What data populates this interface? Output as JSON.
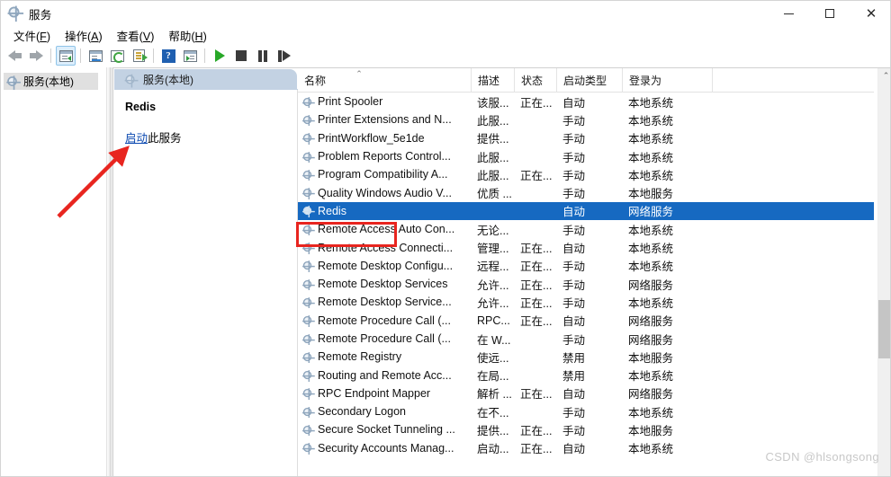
{
  "window": {
    "title": "服务",
    "icon": "services-gear-icon",
    "minimize_label": "—",
    "maximize_label": "□",
    "close_label": "✕"
  },
  "menu": [
    {
      "pre": "文件(",
      "key": "F",
      "post": ")"
    },
    {
      "pre": "操作(",
      "key": "A",
      "post": ")"
    },
    {
      "pre": "查看(",
      "key": "V",
      "post": ")"
    },
    {
      "pre": "帮助(",
      "key": "H",
      "post": ")"
    }
  ],
  "toolbar": [
    {
      "name": "back-button",
      "icon": "arrow-left-icon"
    },
    {
      "name": "forward-button",
      "icon": "arrow-right-icon"
    },
    {
      "name": "show-hide-tree-button",
      "icon": "console-tree-icon"
    },
    {
      "name": "properties-button",
      "icon": "properties-window-icon"
    },
    {
      "name": "refresh-button",
      "icon": "refresh-icon"
    },
    {
      "name": "export-list-button",
      "icon": "export-list-icon"
    },
    {
      "name": "help-button",
      "icon": "help-question-icon"
    },
    {
      "name": "show-action-pane-button",
      "icon": "action-pane-icon"
    },
    {
      "name": "start-service-button",
      "icon": "play-icon"
    },
    {
      "name": "stop-service-button",
      "icon": "stop-icon"
    },
    {
      "name": "pause-service-button",
      "icon": "pause-icon"
    },
    {
      "name": "restart-service-button",
      "icon": "restart-icon"
    }
  ],
  "tree": {
    "root_label": "服务(本地)"
  },
  "pane": {
    "tab_label": "服务(本地)",
    "selected_service": "Redis",
    "action_link": "启动",
    "action_suffix": "此服务"
  },
  "list": {
    "columns": [
      {
        "key": "name",
        "label": "名称",
        "sorted": "asc"
      },
      {
        "key": "desc",
        "label": "描述"
      },
      {
        "key": "state",
        "label": "状态"
      },
      {
        "key": "start",
        "label": "启动类型"
      },
      {
        "key": "logon",
        "label": "登录为"
      }
    ],
    "sort_indicator": "⌃",
    "rows": [
      {
        "name": "Print Spooler",
        "desc": "该服...",
        "state": "正在...",
        "start": "自动",
        "logon": "本地系统",
        "selected": false
      },
      {
        "name": "Printer Extensions and N...",
        "desc": "此服...",
        "state": "",
        "start": "手动",
        "logon": "本地系统",
        "selected": false
      },
      {
        "name": "PrintWorkflow_5e1de",
        "desc": "提供...",
        "state": "",
        "start": "手动",
        "logon": "本地系统",
        "selected": false
      },
      {
        "name": "Problem Reports Control...",
        "desc": "此服...",
        "state": "",
        "start": "手动",
        "logon": "本地系统",
        "selected": false
      },
      {
        "name": "Program Compatibility A...",
        "desc": "此服...",
        "state": "正在...",
        "start": "手动",
        "logon": "本地系统",
        "selected": false
      },
      {
        "name": "Quality Windows Audio V...",
        "desc": "优质 ...",
        "state": "",
        "start": "手动",
        "logon": "本地服务",
        "selected": false
      },
      {
        "name": "Redis",
        "desc": "",
        "state": "",
        "start": "自动",
        "logon": "网络服务",
        "selected": true
      },
      {
        "name": "Remote Access Auto Con...",
        "desc": "无论...",
        "state": "",
        "start": "手动",
        "logon": "本地系统",
        "selected": false
      },
      {
        "name": "Remote Access Connecti...",
        "desc": "管理...",
        "state": "正在...",
        "start": "自动",
        "logon": "本地系统",
        "selected": false
      },
      {
        "name": "Remote Desktop Configu...",
        "desc": "远程...",
        "state": "正在...",
        "start": "手动",
        "logon": "本地系统",
        "selected": false
      },
      {
        "name": "Remote Desktop Services",
        "desc": "允许...",
        "state": "正在...",
        "start": "手动",
        "logon": "网络服务",
        "selected": false
      },
      {
        "name": "Remote Desktop Service...",
        "desc": "允许...",
        "state": "正在...",
        "start": "手动",
        "logon": "本地系统",
        "selected": false
      },
      {
        "name": "Remote Procedure Call (...",
        "desc": "RPC...",
        "state": "正在...",
        "start": "自动",
        "logon": "网络服务",
        "selected": false
      },
      {
        "name": "Remote Procedure Call (...",
        "desc": "在 W...",
        "state": "",
        "start": "手动",
        "logon": "网络服务",
        "selected": false
      },
      {
        "name": "Remote Registry",
        "desc": "使远...",
        "state": "",
        "start": "禁用",
        "logon": "本地服务",
        "selected": false
      },
      {
        "name": "Routing and Remote Acc...",
        "desc": "在局...",
        "state": "",
        "start": "禁用",
        "logon": "本地系统",
        "selected": false
      },
      {
        "name": "RPC Endpoint Mapper",
        "desc": "解析 ...",
        "state": "正在...",
        "start": "自动",
        "logon": "网络服务",
        "selected": false
      },
      {
        "name": "Secondary Logon",
        "desc": "在不...",
        "state": "",
        "start": "手动",
        "logon": "本地系统",
        "selected": false
      },
      {
        "name": "Secure Socket Tunneling ...",
        "desc": "提供...",
        "state": "正在...",
        "start": "手动",
        "logon": "本地服务",
        "selected": false
      },
      {
        "name": "Security Accounts Manag...",
        "desc": "启动...",
        "state": "正在...",
        "start": "自动",
        "logon": "本地系统",
        "selected": false
      }
    ]
  },
  "scrollbar": {
    "up_arrow": "⌃"
  },
  "annotations": {
    "watermark": "CSDN @hlsongsong",
    "highlight_color": "#e8251f",
    "arrow_color": "#e8251f"
  },
  "colors": {
    "selection": "#1669c1",
    "tab": "#c3d2e3",
    "link": "#0a48b0"
  }
}
